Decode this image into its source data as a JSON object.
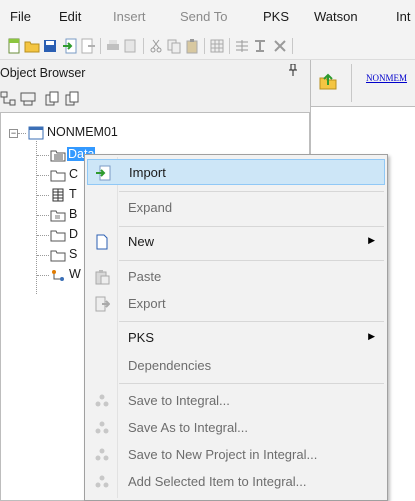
{
  "menubar": {
    "items": [
      {
        "label": "File",
        "enabled": true
      },
      {
        "label": "Edit",
        "enabled": true
      },
      {
        "label": "Insert",
        "enabled": false
      },
      {
        "label": "Send To",
        "enabled": false
      },
      {
        "label": "PKS",
        "enabled": true
      },
      {
        "label": "Watson",
        "enabled": true
      },
      {
        "label": "Int",
        "enabled": true
      }
    ]
  },
  "object_browser": {
    "title": "Object Browser",
    "pin_glyph": "ᵖ",
    "tree": {
      "root": {
        "label": "NONMEM01",
        "expander": "−"
      },
      "selected_child": {
        "label": "Data"
      },
      "partial_children": [
        "C",
        "T",
        "B",
        "D",
        "S",
        "W"
      ]
    }
  },
  "right_pane": {
    "link_text": "NONMEM"
  },
  "context_menu": {
    "items": [
      {
        "label": "Import",
        "enabled": true,
        "highlighted": true,
        "icon": "import-icon"
      },
      {
        "label": "Expand",
        "enabled": false
      },
      {
        "label": "New",
        "enabled": true,
        "submenu": true,
        "icon": "new-document-icon"
      },
      {
        "label": "Paste",
        "enabled": false,
        "icon": "paste-icon"
      },
      {
        "label": "Export",
        "enabled": false,
        "icon": "export-icon"
      },
      {
        "label": "PKS",
        "enabled": true,
        "submenu": true
      },
      {
        "label": "Dependencies",
        "enabled": false
      },
      {
        "label": "Save to Integral...",
        "enabled": false,
        "icon": "integral-icon"
      },
      {
        "label": "Save As to Integral...",
        "enabled": false,
        "icon": "integral-icon"
      },
      {
        "label": "Save to New Project in Integral...",
        "enabled": false,
        "icon": "integral-icon"
      },
      {
        "label": "Add Selected Item to Integral...",
        "enabled": false,
        "icon": "integral-icon"
      }
    ],
    "submenu_arrow": "▶"
  },
  "colors": {
    "selection": "#3399ff",
    "menu_highlight": "#cde6f7",
    "link": "#0000cc"
  }
}
